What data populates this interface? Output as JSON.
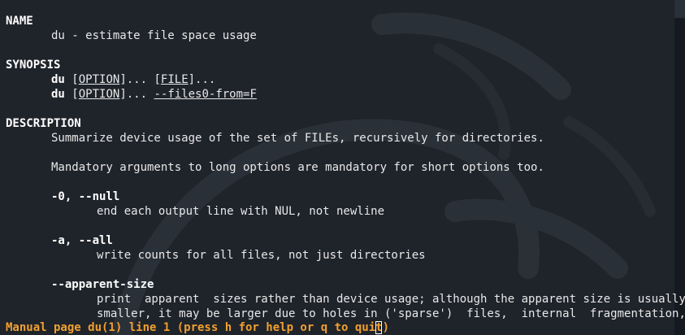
{
  "man": {
    "name_header": "NAME",
    "name_line": "du - estimate file space usage",
    "synopsis_header": "SYNOPSIS",
    "synopsis": [
      {
        "cmd": "du",
        "sp": " ",
        "opt_open": "[",
        "opt": "OPTION",
        "opt_close": "]... ",
        "arg_open": "[",
        "arg": "FILE",
        "arg_close": "]..."
      },
      {
        "cmd": "du",
        "sp": " ",
        "opt_open": "[",
        "opt": "OPTION",
        "opt_close": "]... ",
        "arg": "--files0-from=F"
      }
    ],
    "description_header": "DESCRIPTION",
    "description_line1": "Summarize device usage of the set of FILEs, recursively for directories.",
    "description_line2": "Mandatory arguments to long options are mandatory for short options too.",
    "options": [
      {
        "flag": "-0, --null",
        "desc": "end each output line with NUL, not newline"
      },
      {
        "flag": "-a, --all",
        "desc": "write counts for all files, not just directories"
      },
      {
        "flag": "--apparent-size",
        "desc": "print  apparent  sizes rather than device usage; although the apparent size is usually",
        "desc2": "smaller, it may be larger due to holes in ('sparse')  files,  internal  fragmentation,"
      }
    ]
  },
  "status_bar": {
    "text": "Manual page du(1) line 1 (press h for help or q to quit)"
  },
  "colors": {
    "background": "#1f232a",
    "text": "#e8e8e8",
    "status": "#f0a030"
  }
}
